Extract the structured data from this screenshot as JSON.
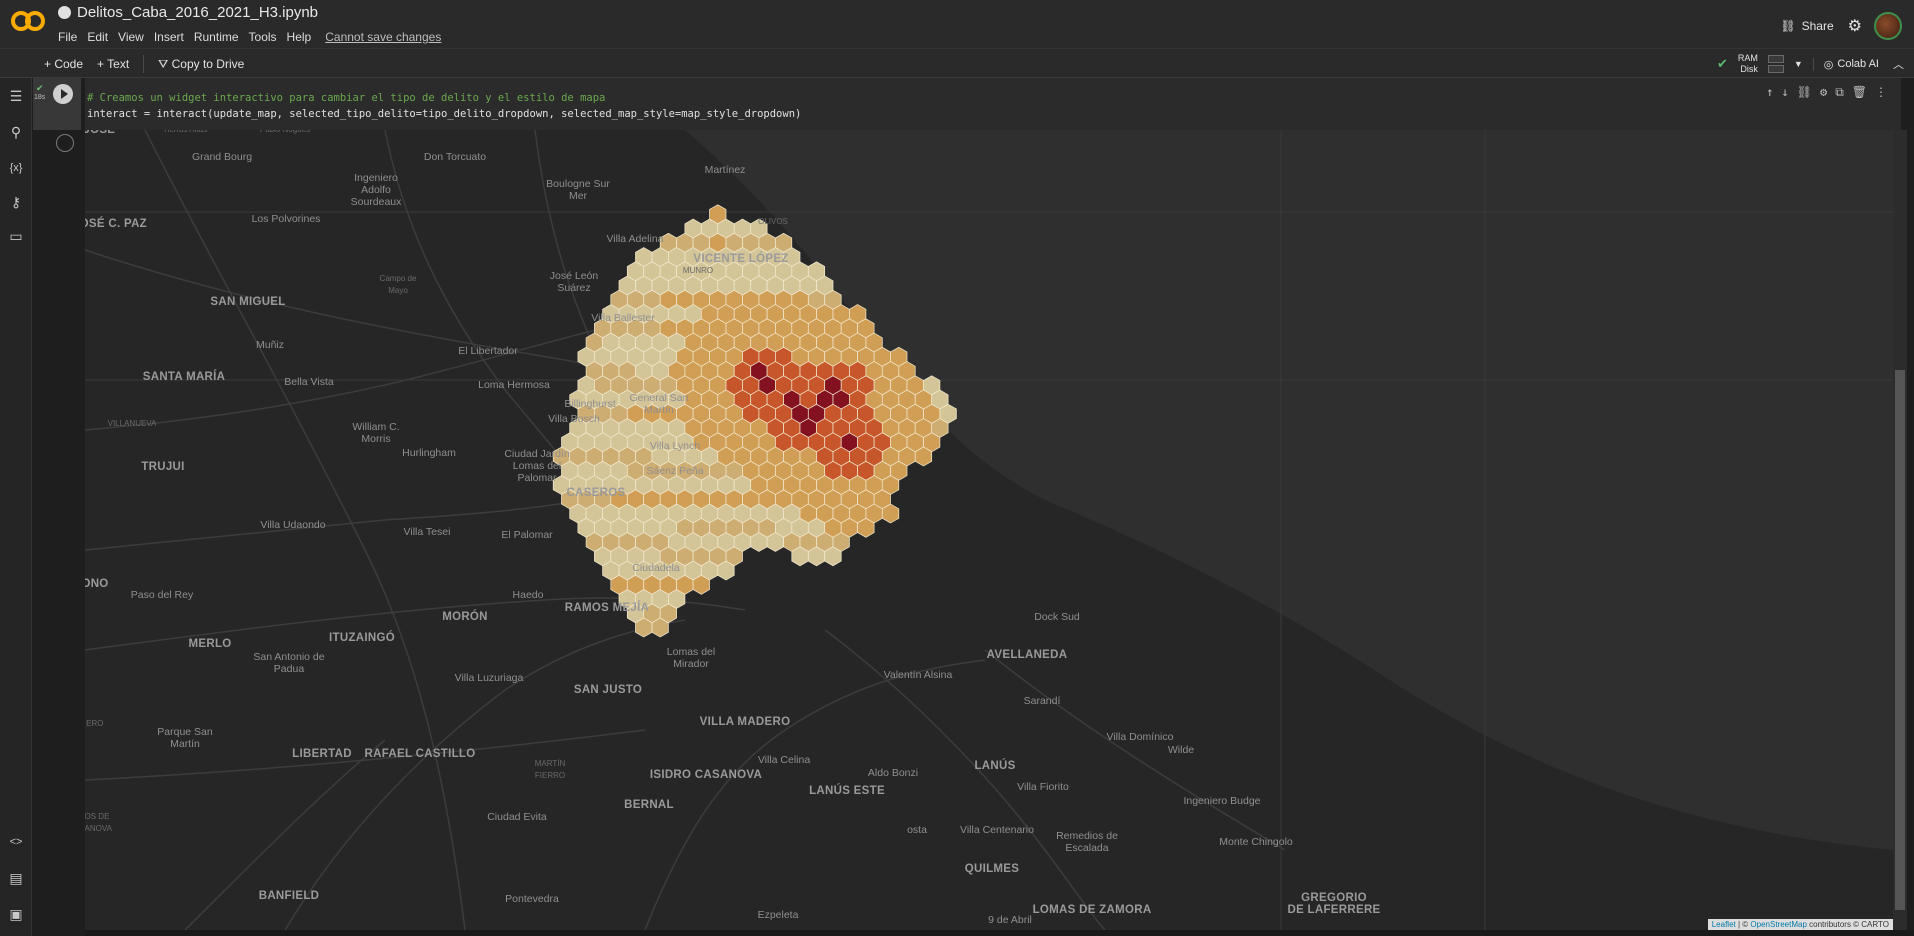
{
  "app": {
    "file_title": "Delitos_Caba_2016_2021_H3.ipynb",
    "menu": [
      "File",
      "Edit",
      "View",
      "Insert",
      "Runtime",
      "Tools",
      "Help"
    ],
    "cannot_save": "Cannot save changes",
    "share_label": "Share",
    "icons": [
      "colab-logo",
      "github-icon",
      "link-icon",
      "gear-icon",
      "avatar"
    ]
  },
  "toolbar": {
    "code_label": "Code",
    "text_label": "Text",
    "copy_label": "Copy to Drive",
    "ram_label": "RAM",
    "disk_label": "Disk",
    "colab_ai_label": "Colab AI"
  },
  "cell": {
    "exec_time": "18s",
    "comment_line": "# Creamos un widget interactivo para cambiar el tipo de delito y el estilo de mapa",
    "code_line": "interact = interact(update_map, selected_tipo_delito=tipo_delito_dropdown, selected_map_style=map_style_dropdown)",
    "tools": [
      "move-up-icon",
      "move-down-icon",
      "link-icon",
      "settings-icon",
      "mirror-icon",
      "delete-icon",
      "more-icon"
    ]
  },
  "map": {
    "attribution_leaflet": "Leaflet",
    "attribution_sep": "| ©",
    "attribution_osm": "OpenStreetMap",
    "attribution_rest": "contributors © CARTO",
    "colors": {
      "low": "#e3d3a3",
      "mid": "#e0a85a",
      "high": "#d55a2a",
      "top": "#8b0f1e"
    },
    "labels": [
      {
        "text": "Tierras Altas",
        "cls": "small"
      },
      {
        "text": "Pablo Nogues",
        "cls": "small"
      },
      {
        "text": "Grand Bourg",
        "cls": ""
      },
      {
        "text": "Don Torcuato",
        "cls": ""
      },
      {
        "text": "Martínez",
        "cls": ""
      },
      {
        "text": "Ingeniero\nAdolfo\nSourdeaux",
        "cls": ""
      },
      {
        "text": "Boulogne Sur\nMer",
        "cls": ""
      },
      {
        "text": "OLIVOS",
        "cls": "small"
      },
      {
        "text": "JOSÉ C. PAZ",
        "cls": "big"
      },
      {
        "text": "Los Polvorines",
        "cls": ""
      },
      {
        "text": "Villa Adelina",
        "cls": ""
      },
      {
        "text": "VICENTE LÓPEZ",
        "cls": "big"
      },
      {
        "text": "MUNRO",
        "cls": "small"
      },
      {
        "text": "Campo de\nMayo",
        "cls": "small"
      },
      {
        "text": "José León\nSuárez",
        "cls": ""
      },
      {
        "text": "SAN MIGUEL",
        "cls": "big"
      },
      {
        "text": "Villa Ballester",
        "cls": ""
      },
      {
        "text": "Muñiz",
        "cls": ""
      },
      {
        "text": "El Libertador",
        "cls": ""
      },
      {
        "text": "SANTA MARÍA",
        "cls": "big"
      },
      {
        "text": "Bella Vista",
        "cls": ""
      },
      {
        "text": "Loma Hermosa",
        "cls": ""
      },
      {
        "text": "Billinghurst",
        "cls": ""
      },
      {
        "text": "General San\nMartín",
        "cls": ""
      },
      {
        "text": "Villa Bosch",
        "cls": ""
      },
      {
        "text": "VILLANUEVA",
        "cls": "small"
      },
      {
        "text": "William C.\nMorris",
        "cls": ""
      },
      {
        "text": "Villa Lynch",
        "cls": ""
      },
      {
        "text": "Hurlingham",
        "cls": ""
      },
      {
        "text": "Ciudad Jardín\nLomas del\nPalomar",
        "cls": ""
      },
      {
        "text": "TRUJUI",
        "cls": "big"
      },
      {
        "text": "Sáenz Peña",
        "cls": ""
      },
      {
        "text": "CASEROS",
        "cls": "big"
      },
      {
        "text": "Villa Udaondo",
        "cls": ""
      },
      {
        "text": "Villa Tesei",
        "cls": ""
      },
      {
        "text": "El Palomar",
        "cls": ""
      },
      {
        "text": "Ciudadela",
        "cls": ""
      },
      {
        "text": "ONO",
        "cls": "big"
      },
      {
        "text": "Paso del Rey",
        "cls": ""
      },
      {
        "text": "Haedo",
        "cls": ""
      },
      {
        "text": "RAMOS MEJÍA",
        "cls": "big"
      },
      {
        "text": "MORÓN",
        "cls": "big"
      },
      {
        "text": "Dock Sud",
        "cls": ""
      },
      {
        "text": "MERLO",
        "cls": "big"
      },
      {
        "text": "ITUZAINGÓ",
        "cls": "big"
      },
      {
        "text": "San Antonio de\nPadua",
        "cls": ""
      },
      {
        "text": "Lomas del\nMirador",
        "cls": ""
      },
      {
        "text": "Valentín Alsina",
        "cls": ""
      },
      {
        "text": "AVELLANEDA",
        "cls": "big"
      },
      {
        "text": "Villa Luzuriaga",
        "cls": ""
      },
      {
        "text": "SAN JUSTO",
        "cls": "big"
      },
      {
        "text": "Sarandí",
        "cls": ""
      },
      {
        "text": "ECO ERO",
        "cls": "small"
      },
      {
        "text": "VILLA MADERO",
        "cls": "big"
      },
      {
        "text": "Parque San\nMartín",
        "cls": ""
      },
      {
        "text": "Villa Domínico",
        "cls": ""
      },
      {
        "text": "Wilde",
        "cls": ""
      },
      {
        "text": "LIBERTAD",
        "cls": "big"
      },
      {
        "text": "RAFAEL CASTILLO",
        "cls": "big"
      },
      {
        "text": "Villa Celina",
        "cls": ""
      },
      {
        "text": "LANÚS",
        "cls": "big"
      },
      {
        "text": "MARTÍN\nFIERRO",
        "cls": "small"
      },
      {
        "text": "ISIDRO CASANOVA",
        "cls": "big"
      },
      {
        "text": "Aldo Bonzi",
        "cls": ""
      },
      {
        "text": "Villa Fiorito",
        "cls": ""
      },
      {
        "text": "LANÚS ESTE",
        "cls": "big"
      },
      {
        "text": "Ingeniero Budge",
        "cls": ""
      },
      {
        "text": "BERNAL",
        "cls": "big"
      },
      {
        "text": "Ciudad Evita",
        "cls": ""
      },
      {
        "text": "ALTOS DE\nCASANOVA",
        "cls": "small"
      },
      {
        "text": "osta",
        "cls": ""
      },
      {
        "text": "Villa Centenario",
        "cls": ""
      },
      {
        "text": "Remedios de\nEscalada",
        "cls": ""
      },
      {
        "text": "Monte Chingolo",
        "cls": ""
      },
      {
        "text": "QUILMES",
        "cls": "big"
      },
      {
        "text": "BANFIELD",
        "cls": "big"
      },
      {
        "text": "Pontevedra",
        "cls": ""
      },
      {
        "text": "GREGORIO\nDE LAFERRERE",
        "cls": "big"
      },
      {
        "text": "Ezpeleta",
        "cls": ""
      },
      {
        "text": "9 de Abril",
        "cls": ""
      },
      {
        "text": "LOMAS DE ZAMORA",
        "cls": "big"
      },
      {
        "text": "SAN JOSÉ",
        "cls": "big"
      }
    ]
  }
}
